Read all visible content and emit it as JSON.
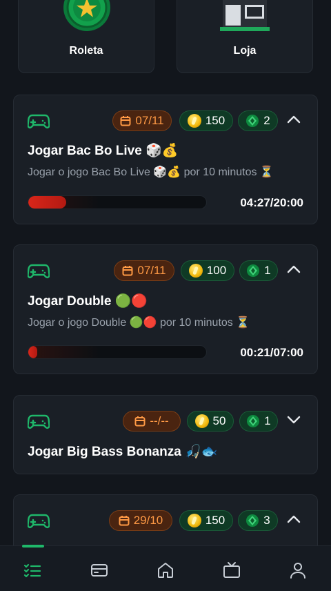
{
  "tiles": [
    {
      "label": "Roleta",
      "icon": "roulette-star-icon"
    },
    {
      "label": "Loja",
      "icon": "store-icon"
    }
  ],
  "missions": [
    {
      "date": "07/11",
      "coins": "150",
      "gems": "2",
      "expanded": true,
      "title": "Jogar Bac Bo Live 🎲💰",
      "description": "Jogar o jogo Bac Bo Live 🎲💰 por 10 minutos ⏳",
      "progress": 0.2135,
      "timer": "04:27/20:00"
    },
    {
      "date": "07/11",
      "coins": "100",
      "gems": "1",
      "expanded": true,
      "title": "Jogar Double 🟢🔴",
      "description": "Jogar o jogo Double 🟢🔴 por 10 minutos ⏳",
      "progress": 0.05,
      "timer": "00:21/07:00"
    },
    {
      "date": "--/--",
      "coins": "50",
      "gems": "1",
      "expanded": false,
      "title": "Jogar Big Bass Bonanza 🎣🐟"
    },
    {
      "date": "29/10",
      "coins": "150",
      "gems": "3",
      "expanded": true,
      "title": ""
    }
  ],
  "colors": {
    "background": "#12161c",
    "card": "#1a1f26",
    "accent_green": "#1fb86a",
    "date_orange": "#ff9a45",
    "progress_red": "#d8261a"
  },
  "nav": [
    {
      "icon": "missions-list-icon",
      "active": true
    },
    {
      "icon": "wallet-card-icon"
    },
    {
      "icon": "home-icon"
    },
    {
      "icon": "tv-icon"
    },
    {
      "icon": "profile-icon"
    }
  ]
}
